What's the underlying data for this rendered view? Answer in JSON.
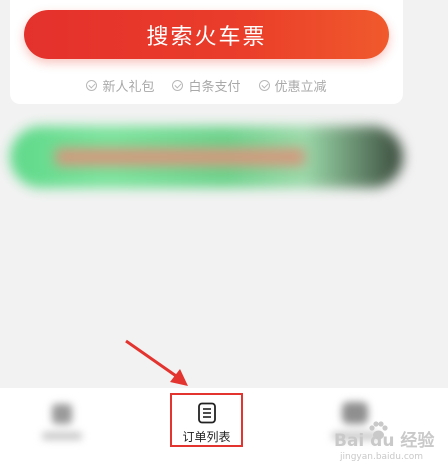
{
  "search": {
    "button_label": "搜索火车票",
    "perks": [
      "新人礼包",
      "白条支付",
      "优惠立减"
    ]
  },
  "promo_banner": {
    "state": "blurred"
  },
  "bottom_nav": {
    "items": [
      {
        "state": "blurred"
      },
      {
        "label": "订单列表",
        "icon": "order-list-icon",
        "highlighted": true
      },
      {
        "state": "blurred"
      }
    ]
  },
  "annotation": {
    "arrow_color": "#e3342f",
    "highlight_color": "#e3342f"
  },
  "watermark": {
    "brand": "Bai du 经验",
    "url": "jingyan.baidu.com"
  },
  "colors": {
    "accent": "#e4312c",
    "background": "#f2f2f2"
  }
}
